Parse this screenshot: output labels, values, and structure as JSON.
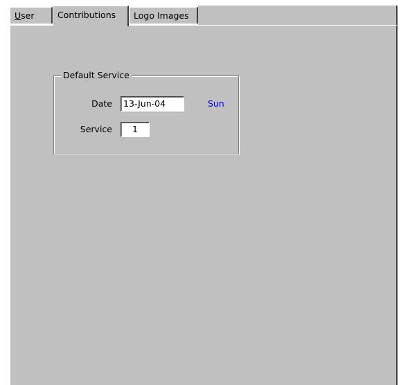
{
  "tabs": [
    {
      "label_accel": "U",
      "label_rest": "ser",
      "active": false
    },
    {
      "label": "Contributions",
      "active": true
    },
    {
      "label_pre": "Lo",
      "label_accel": "g",
      "label_rest": "o Images",
      "active": false
    }
  ],
  "default_service": {
    "title": "Default Service",
    "date_label": "Date",
    "date_value": "13-Jun-04",
    "day_text": "Sun",
    "service_label": "Service",
    "service_value": "1"
  },
  "colors": {
    "face": "#c0c0c0",
    "highlight": "#ffffff",
    "shadow": "#808080",
    "dark_shadow": "#404040",
    "day_text": "#0000ff"
  }
}
